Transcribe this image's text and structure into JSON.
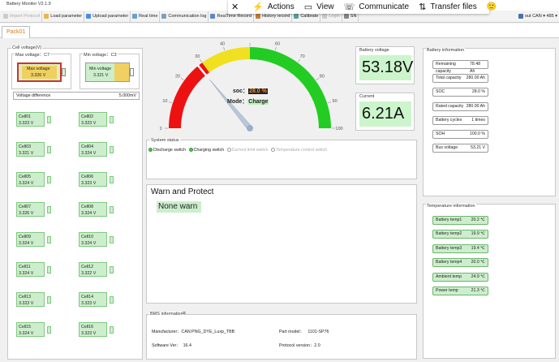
{
  "window": {
    "title": "Battery Monitor V2.1.9"
  },
  "toolbar": {
    "items": [
      {
        "label": "Import Protocol",
        "enabled": false
      },
      {
        "label": "Load parameter",
        "enabled": true
      },
      {
        "label": "Upload parameter",
        "enabled": true
      },
      {
        "label": "Real time",
        "enabled": true
      },
      {
        "label": "Communication log",
        "enabled": true
      },
      {
        "label": "RealTime Record",
        "enabled": true
      },
      {
        "label": "History record",
        "enabled": true
      },
      {
        "label": "Calibrate",
        "enabled": true
      },
      {
        "label": "Login",
        "enabled": false
      },
      {
        "label": "SN",
        "enabled": true
      }
    ],
    "port_label": "out",
    "protocol": "CAN",
    "protocol_value": "485"
  },
  "overlay": {
    "close": "✕",
    "actions": "Actions",
    "view": "View",
    "communicate": "Communicate",
    "transfer": "Transfer files",
    "emoji": "🙂"
  },
  "tab": {
    "label": "Pack01"
  },
  "cell_voltage": {
    "title": "Cell voltage(V)",
    "max": {
      "label": "Max voltage：C7",
      "name": "Max voltage",
      "value": "3.326 V"
    },
    "min": {
      "label": "Min voltage：C3",
      "name": "Min voltage",
      "value": "3.321 V"
    },
    "diff_label": "Voltage difference",
    "diff_value": "5.000mV",
    "cells": [
      {
        "name": "Cell01",
        "value": "3.323 V"
      },
      {
        "name": "Cell02",
        "value": "3.323 V"
      },
      {
        "name": "Cell03",
        "value": "3.321 V"
      },
      {
        "name": "Cell04",
        "value": "3.324 V"
      },
      {
        "name": "Cell05",
        "value": "3.324 V"
      },
      {
        "name": "Cell06",
        "value": "3.323 V"
      },
      {
        "name": "Cell07",
        "value": "3.326 V"
      },
      {
        "name": "Cell08",
        "value": "3.324 V"
      },
      {
        "name": "Cell09",
        "value": "3.324 V"
      },
      {
        "name": "Cell10",
        "value": "3.324 V"
      },
      {
        "name": "Cell11",
        "value": "3.324 V"
      },
      {
        "name": "Cell12",
        "value": "3.322 V"
      },
      {
        "name": "Cell13",
        "value": "3.323 V"
      },
      {
        "name": "Cell14",
        "value": "3.323 V"
      },
      {
        "name": "Cell15",
        "value": "3.324 V"
      },
      {
        "name": "Cell16",
        "value": "3.323 V"
      }
    ]
  },
  "gauge": {
    "ticks": [
      "0",
      "10",
      "20",
      "30",
      "40",
      "50",
      "60",
      "70",
      "80",
      "90",
      "100"
    ],
    "soc_label": "soc：",
    "soc_value": "28.0 %",
    "soc_percent": 28.0,
    "mode_label": "Mode：",
    "mode_value": "Charge",
    "colors": {
      "red": "#ee1111",
      "yellow": "#f0e020",
      "green": "#22cc22"
    }
  },
  "battery_voltage": {
    "label": "Battery voltage",
    "value": "53.18V"
  },
  "current": {
    "label": "Current",
    "value": "6.21A"
  },
  "system_status": {
    "title": "System status",
    "switches": [
      {
        "label": "Discharge switch",
        "on": true
      },
      {
        "label": "Charging switch",
        "on": true
      },
      {
        "label": "Current limit switch",
        "on": false
      },
      {
        "label": "Temperature control switch",
        "on": false
      }
    ]
  },
  "warn": {
    "title": "Warn and Protect",
    "value": "None warn"
  },
  "bms_info": {
    "title": "BMS information",
    "manufacturer_label": "Manufacturer：",
    "manufacturer_value": "CAN:PNG_DYE_Luxp_TBB",
    "part_label": "Part model：",
    "part_value": "1101-SP76",
    "software_label": "Software Ver：",
    "software_value": "16.4",
    "protocol_label": "Protocol version：",
    "protocol_value": "2.0"
  },
  "battery_info": {
    "title": "Battery information",
    "rows": [
      {
        "label": "Remaining capacity",
        "value": "78.48 Ah"
      },
      {
        "label": "Total capacity",
        "value": "280.00 Ah"
      },
      {
        "label": "SOC",
        "value": "28.0 %"
      },
      {
        "label": "Rated capacity",
        "value": "280.00 Ah"
      },
      {
        "label": "Battery cycles",
        "value": "1 times"
      },
      {
        "label": "SOH",
        "value": "100.0 %"
      },
      {
        "label": "Bus voltage",
        "value": "53.21 V"
      }
    ]
  },
  "temperature": {
    "title": "Temperature information",
    "rows": [
      {
        "label": "Battery temp1",
        "value": "20.2 ℃"
      },
      {
        "label": "Battery temp2",
        "value": "19.9 ℃"
      },
      {
        "label": "Battery temp3",
        "value": "19.4 ℃"
      },
      {
        "label": "Battery temp4",
        "value": "20.0 ℃"
      },
      {
        "label": "Ambient temp",
        "value": "24.9 ℃"
      },
      {
        "label": "Power temp",
        "value": "21.3 ℃"
      }
    ]
  }
}
